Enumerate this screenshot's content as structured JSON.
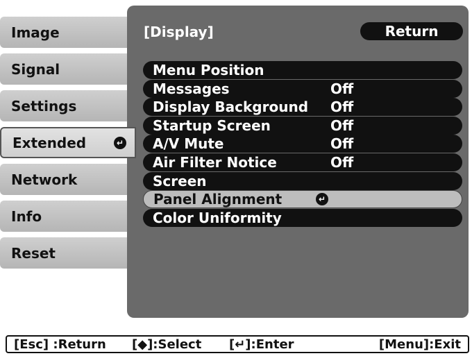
{
  "nav": {
    "items": [
      {
        "label": "Image"
      },
      {
        "label": "Signal"
      },
      {
        "label": "Settings"
      },
      {
        "label": "Extended"
      },
      {
        "label": "Network"
      },
      {
        "label": "Info"
      },
      {
        "label": "Reset"
      }
    ],
    "enter_glyph": "↵"
  },
  "panel": {
    "title": "[Display]",
    "return_label": "Return",
    "rows": [
      {
        "label": "Menu Position",
        "value": ""
      },
      {
        "label": "Messages",
        "value": "Off"
      },
      {
        "label": "Display Background",
        "value": "Off"
      },
      {
        "label": "Startup Screen",
        "value": "Off"
      },
      {
        "label": "A/V Mute",
        "value": "Off"
      },
      {
        "label": "Air Filter Notice",
        "value": "Off"
      },
      {
        "label": "Screen",
        "value": ""
      },
      {
        "label": "Panel Alignment",
        "value": ""
      },
      {
        "label": "Color Uniformity",
        "value": ""
      }
    ]
  },
  "footer": {
    "esc": "[Esc] :Return",
    "select": "[◆]:Select",
    "enter": "[↵]:Enter",
    "exit": "[Menu]:Exit"
  },
  "colors": {
    "panel_bg": "#6a6a6a",
    "row_bg": "#111111",
    "highlight_bg": "#bdbdbd"
  }
}
